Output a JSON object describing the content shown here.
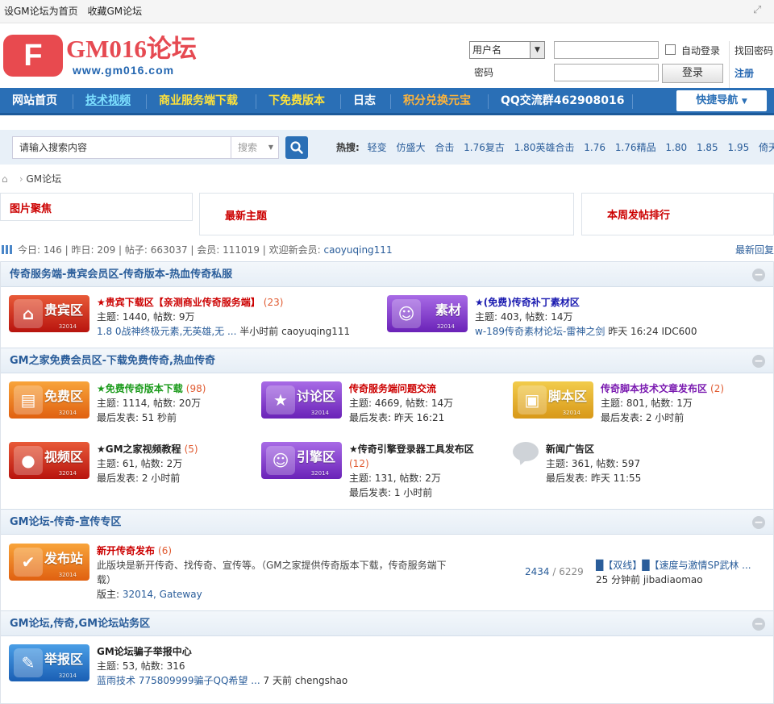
{
  "topbar": {
    "set_home": "设GM论坛为首页",
    "bookmark": "收藏GM论坛"
  },
  "logo": {
    "letter": "F",
    "name": "GM016论坛",
    "url": "www.gm016.com"
  },
  "login": {
    "username_label": "用户名",
    "password_label": "密码",
    "auto_login": "自动登录",
    "login_button": "登录",
    "find_password": "找回密码",
    "register": "注册"
  },
  "nav": {
    "items": [
      {
        "label": "网站首页",
        "color": "#ffffff"
      },
      {
        "label": "技术视频",
        "color": "#7de0ff"
      },
      {
        "label": "商业服务端下载",
        "color": "#ffe23a"
      },
      {
        "label": "下免费版本",
        "color": "#ffe23a"
      },
      {
        "label": "日志",
        "color": "#ffffff"
      },
      {
        "label": "积分兑换元宝",
        "color": "#ffb43a"
      },
      {
        "label": "QQ交流群462908016",
        "color": "#ffffff"
      }
    ],
    "quick_nav": "快捷导航"
  },
  "search": {
    "placeholder": "请输入搜索内容",
    "type": "搜索",
    "hot_label": "热搜:",
    "hot": [
      "轻变",
      "仿盛大",
      "合击",
      "1.76复古",
      "1.80英雄合击",
      "1.76",
      "1.76精品",
      "1.80",
      "1.85",
      "1.95",
      "倚天荣耀"
    ]
  },
  "breadcrumb": {
    "current": "GM论坛"
  },
  "boxes": {
    "pictures": "图片聚焦",
    "latest": "最新主题",
    "weekly": "本周发帖排行"
  },
  "stats": {
    "today_label": "今日:",
    "today": "146",
    "yesterday_label": "昨日:",
    "yesterday": "209",
    "posts_label": "帖子:",
    "posts": "663037",
    "members_label": "会员:",
    "members": "111019",
    "welcome_label": "欢迎新会员:",
    "new_member": "caoyuqing111",
    "latest_reply": "最新回复"
  },
  "categories": [
    {
      "title": "传奇服务端-贵宾会员区-传奇版本-热血传奇私服"
    },
    {
      "title": "GM之家免费会员区-下载免费传奇,热血传奇"
    },
    {
      "title": "GM论坛-传奇-宣传专区"
    },
    {
      "title": "GM论坛,传奇,GM论坛站务区"
    }
  ],
  "collapse_symbol": "−",
  "forums": {
    "vip": {
      "icon_text": "贵宾区",
      "year": "32014",
      "name": "★贵宾下载区【亲测商业传奇服务端】",
      "name_color": "#cc0000",
      "count": "(23)",
      "meta": "主题: 1440, 帖数: 9万",
      "last_title": "1.8 0战神终极元素,无英雄,无 ...",
      "last_time": "半小时前",
      "last_user": "caoyuqing111"
    },
    "material": {
      "icon_text": "素材",
      "year": "32014",
      "name": "★(免费)传奇补丁素材区",
      "name_color": "#1a1ab0",
      "meta": "主题: 403, 帖数: 14万",
      "last_title": "w-189传奇素材论坛-雷神之剑",
      "last_time": "昨天 16:24",
      "last_user": "IDC600"
    },
    "free": {
      "icon_text": "免费区",
      "year": "32014",
      "name": "★免费传奇版本下载",
      "name_color": "#1a9a1a",
      "count": "(98)",
      "meta": "主题: 1114, 帖数: 20万",
      "last": "最后发表: 51 秒前"
    },
    "discuss": {
      "icon_text": "讨论区",
      "year": "32014",
      "name": "传奇服务端问题交流",
      "name_color": "#cc0000",
      "meta": "主题: 4669, 帖数: 14万",
      "last": "最后发表: 昨天 16:21"
    },
    "script": {
      "icon_text": "脚本区",
      "year": "32014",
      "name": "传奇脚本技术文章发布区",
      "name_color": "#7a1ab0",
      "count": "(2)",
      "meta": "主题: 801, 帖数: 1万",
      "last": "最后发表: 2 小时前"
    },
    "video": {
      "icon_text": "视频区",
      "year": "32014",
      "name": "★GM之家视频教程",
      "name_color": "#222222",
      "count": "(5)",
      "meta": "主题: 61, 帖数: 2万",
      "last": "最后发表: 2 小时前"
    },
    "engine": {
      "icon_text": "引擎区",
      "year": "32014",
      "name": "★传奇引擎登录器工具发布区",
      "name_color": "#222222",
      "count": "(12)",
      "meta": "主题: 131, 帖数: 2万",
      "last": "最后发表: 1 小时前"
    },
    "news": {
      "name": "新闻广告区",
      "name_color": "#222222",
      "meta": "主题: 361, 帖数: 597",
      "last": "最后发表: 昨天 11:55"
    },
    "publish": {
      "icon_text": "发布站",
      "year": "32014",
      "name": "新开传奇发布",
      "name_color": "#cc0000",
      "count": "(6)",
      "desc": "此版块是新开传奇、找传奇、宣传等。（GM之家提供传奇版本下载，传奇服务端下载）",
      "moderator_label": "版主:",
      "moderators": "32014, Gateway",
      "threads": "2434",
      "posts": "6229",
      "recent_title": "█【双线】█【速度与激情SP武林 ...",
      "recent_time": "25 分钟前",
      "recent_user": "jibadiaomao"
    },
    "report": {
      "icon_text": "举报区",
      "year": "32014",
      "name": "GM论坛骗子举报中心",
      "name_color": "#222222",
      "meta": "主题: 53, 帖数: 316",
      "last_title": "蓝雨技术 775809999骗子QQ希望 ...",
      "last_time": "7 天前",
      "last_user": "chengshao"
    }
  }
}
